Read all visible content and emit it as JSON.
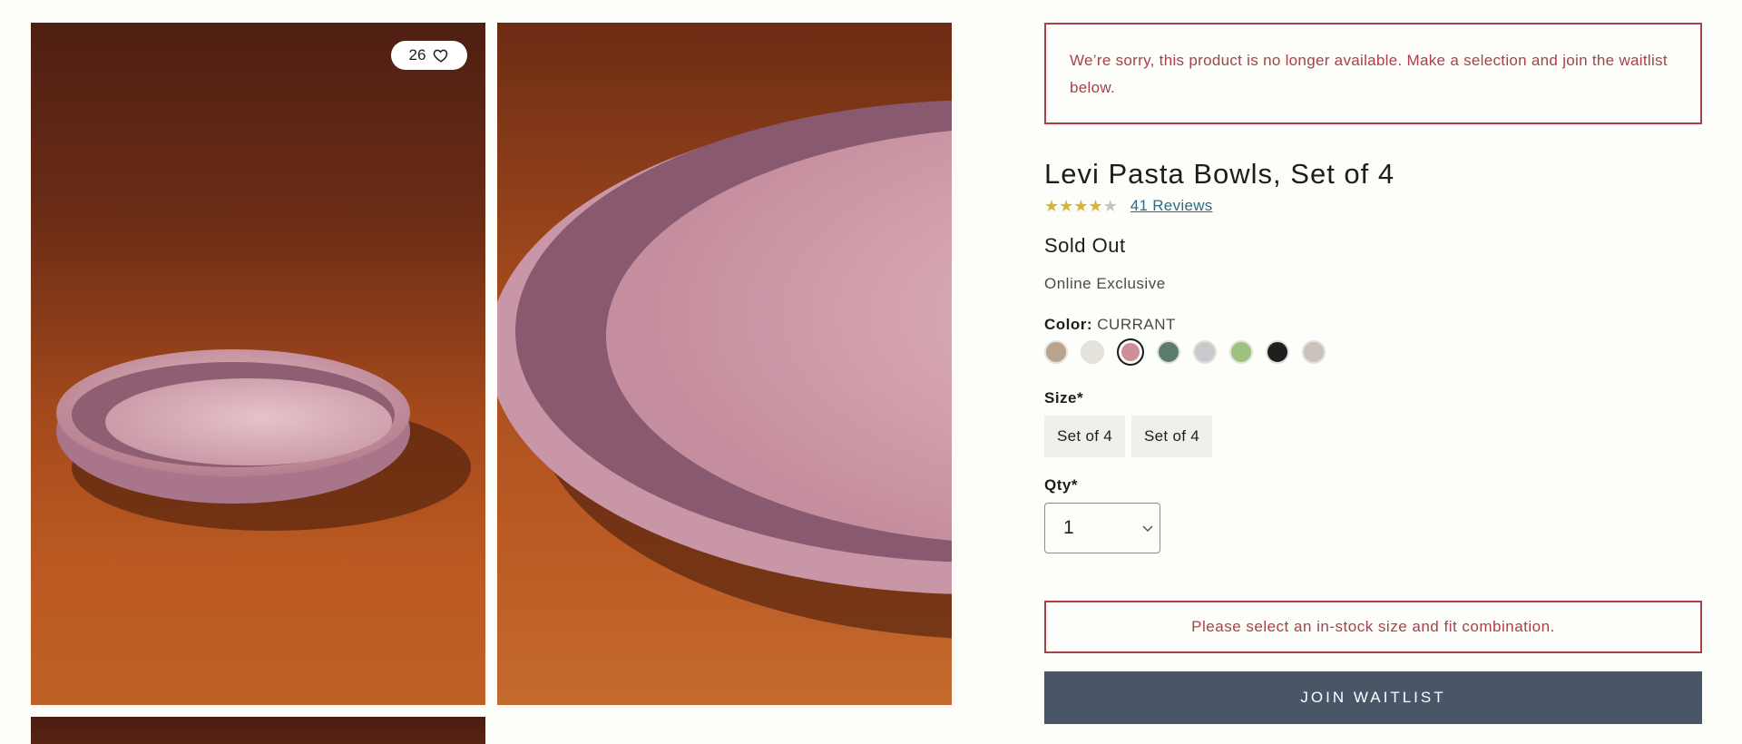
{
  "gallery": {
    "favorite_count": "26"
  },
  "alerts": {
    "unavailable": "We’re sorry, this product is no longer available. Make a selection and join the waitlist below.",
    "select_combo": "Please select an in-stock size and fit combination."
  },
  "product": {
    "title": "Levi Pasta Bowls, Set of 4",
    "rating": 4,
    "rating_max": 5,
    "reviews_label": "41 Reviews",
    "stock_status": "Sold Out",
    "badge": "Online Exclusive"
  },
  "color": {
    "label": "Color:",
    "selected": "CURRANT",
    "swatches": [
      {
        "hex": "#b9a58e"
      },
      {
        "hex": "#e5e2da"
      },
      {
        "hex": "#cf8f99",
        "selected": true
      },
      {
        "hex": "#5c7d6e"
      },
      {
        "hex": "#c9cacc"
      },
      {
        "hex": "#9ec17d"
      },
      {
        "hex": "#1e1f1f"
      },
      {
        "hex": "#c9c2ba"
      }
    ]
  },
  "size": {
    "label": "Size*",
    "options": [
      "Set of 4",
      "Set of 4"
    ]
  },
  "qty": {
    "label": "Qty*",
    "value": "1"
  },
  "actions": {
    "join_waitlist": "JOIN WAITLIST"
  },
  "colors": {
    "alert": "#a8414b",
    "link": "#2d6b86",
    "button": "#4a5568",
    "star": "#d8b33a"
  }
}
